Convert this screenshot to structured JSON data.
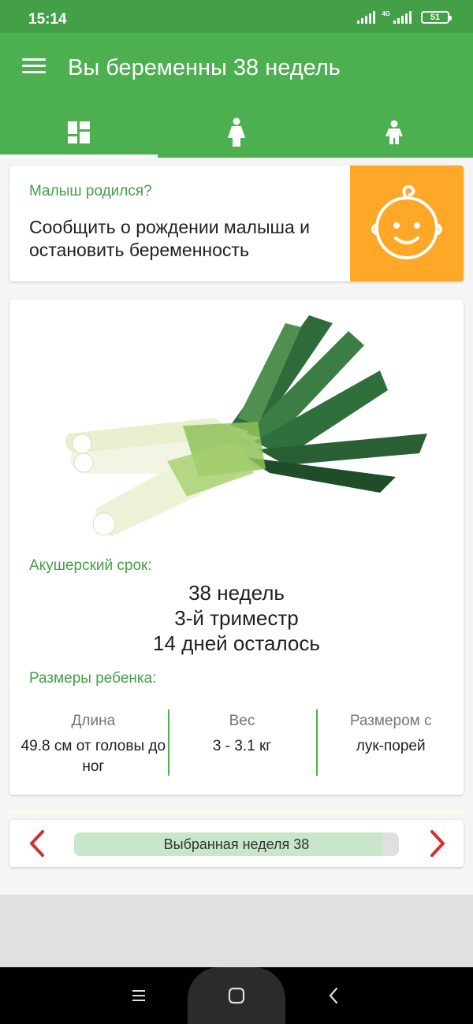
{
  "status_bar": {
    "time": "15:14",
    "network": "4G",
    "battery": "51"
  },
  "app_bar": {
    "title": "Вы беременны 38 недель"
  },
  "tabs": [
    {
      "icon": "dashboard-icon",
      "active": true
    },
    {
      "icon": "woman-icon",
      "active": false
    },
    {
      "icon": "child-icon",
      "active": false
    }
  ],
  "birth_card": {
    "title": "Малыш родился?",
    "text": "Сообщить о рождении малыша и остановить беременность",
    "icon": "baby-face-icon",
    "accent": "#ffa726"
  },
  "week_info": {
    "image": "leek-image",
    "term_label": "Акушерский срок:",
    "weeks": "38 недель",
    "trimester": "3-й триместр",
    "days_left": "14 дней осталось",
    "size_label": "Размеры ребенка:",
    "sizes": [
      {
        "head": "Длина",
        "value": "49.8 см от головы до ног"
      },
      {
        "head": "Вес",
        "value": "3 - 3.1 кг"
      },
      {
        "head": "Размером с",
        "value": "лук-порей"
      }
    ]
  },
  "week_selector": {
    "label": "Выбранная неделя 38",
    "progress": 0.95
  },
  "colors": {
    "primary": "#4caf50",
    "primary_dark": "#43a047",
    "accent_text": "#43a047",
    "arrow": "#d32f2f"
  }
}
